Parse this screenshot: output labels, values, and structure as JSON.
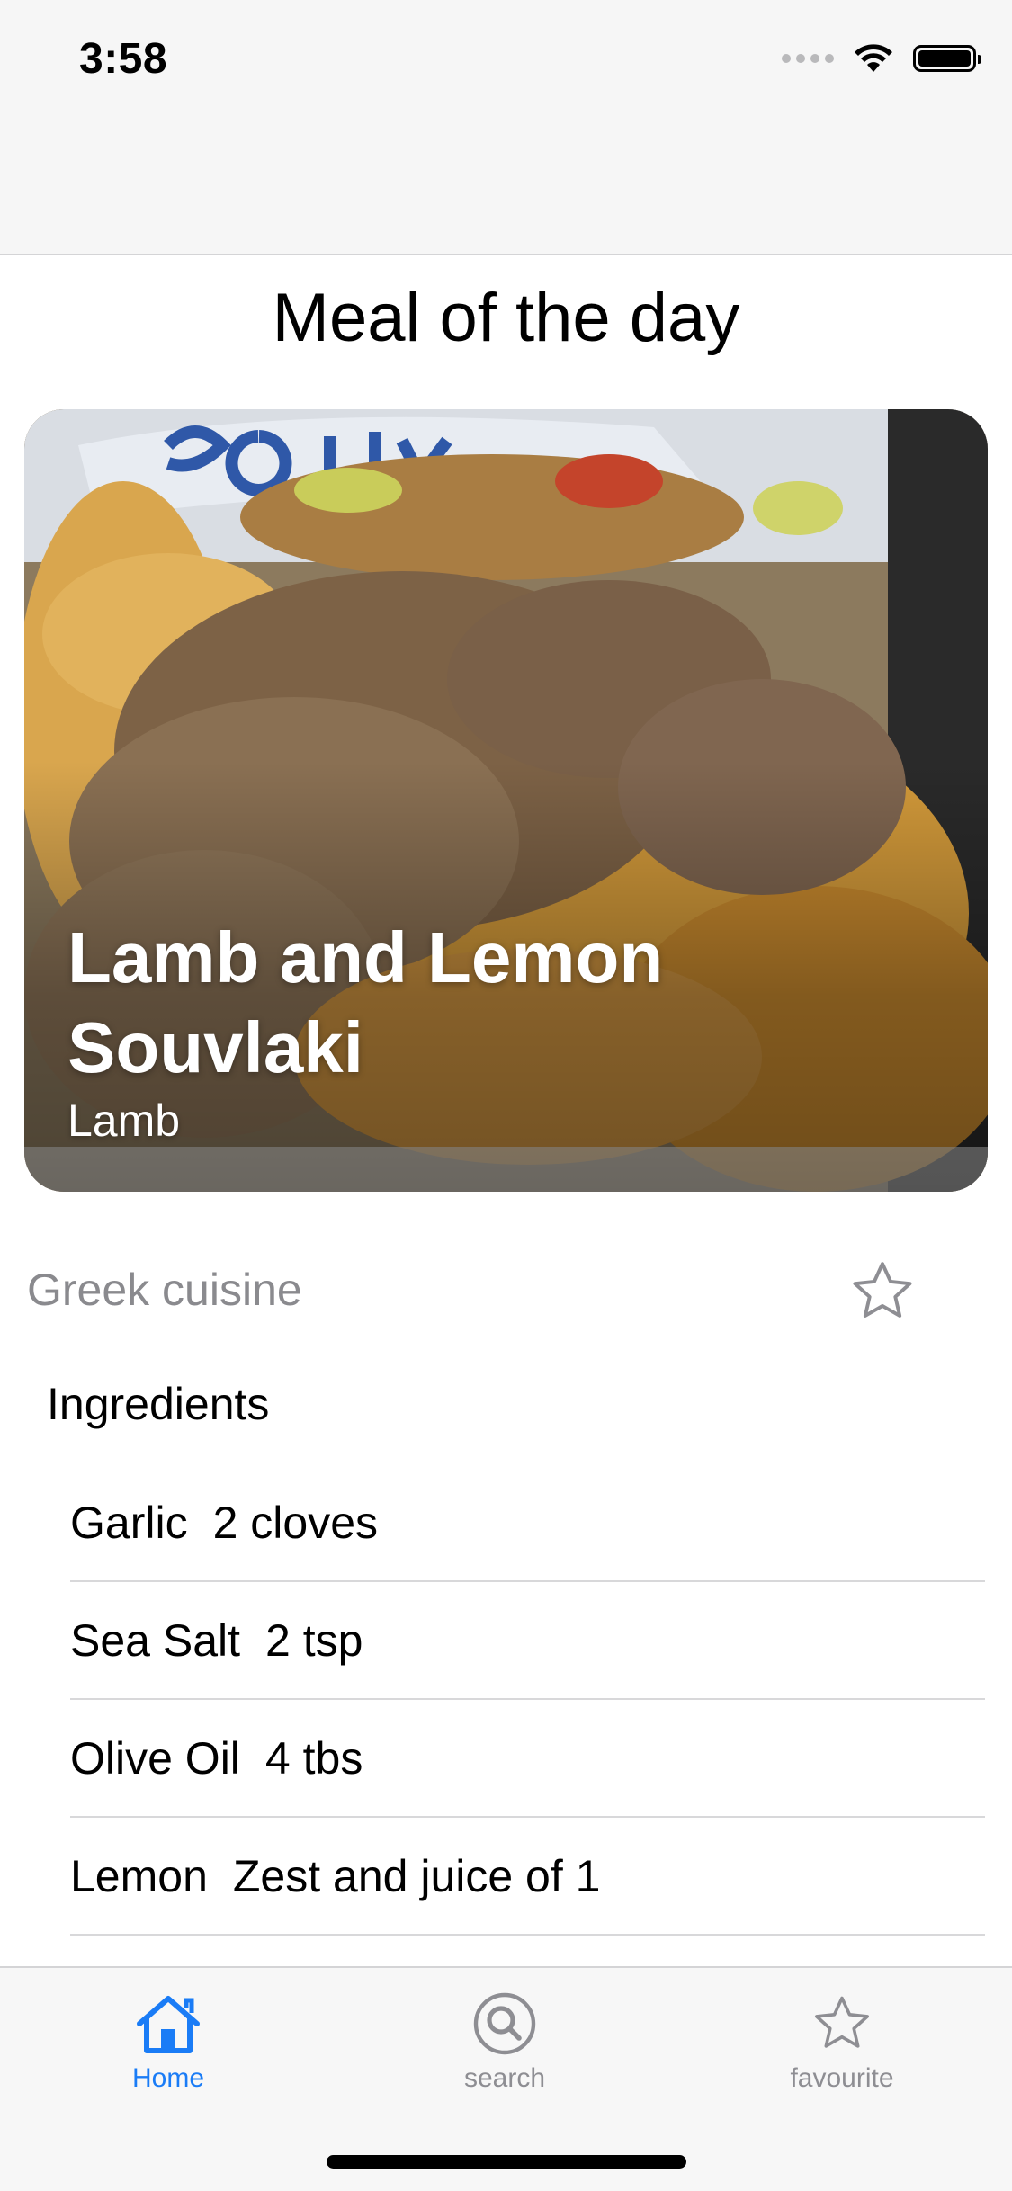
{
  "status_bar": {
    "time": "3:58",
    "icons": [
      "signal-icon",
      "wifi-icon",
      "battery-icon"
    ]
  },
  "header": {
    "title": "Meal of the day"
  },
  "meal": {
    "name": "Lamb and Lemon Souvlaki",
    "category": "Lamb",
    "cuisine": "Greek cuisine",
    "favourite_icon": "star-outline-icon",
    "ingredients_heading": "Ingredients",
    "ingredients": [
      {
        "name": "Garlic",
        "measure": "2 cloves"
      },
      {
        "name": "Sea Salt",
        "measure": "2 tsp"
      },
      {
        "name": "Olive Oil",
        "measure": "4 tbs"
      },
      {
        "name": "Lemon",
        "measure": "Zest and juice of 1"
      }
    ]
  },
  "tab_bar": {
    "tabs": [
      {
        "label": "Home",
        "icon": "house-icon",
        "active": true
      },
      {
        "label": "search",
        "icon": "magnifier-icon",
        "active": false
      },
      {
        "label": "favourite",
        "icon": "star-icon",
        "active": false
      }
    ]
  },
  "colors": {
    "accent": "#1a7cf6",
    "inactive": "#8e8e93",
    "secondary_text": "#8a8a8e"
  }
}
